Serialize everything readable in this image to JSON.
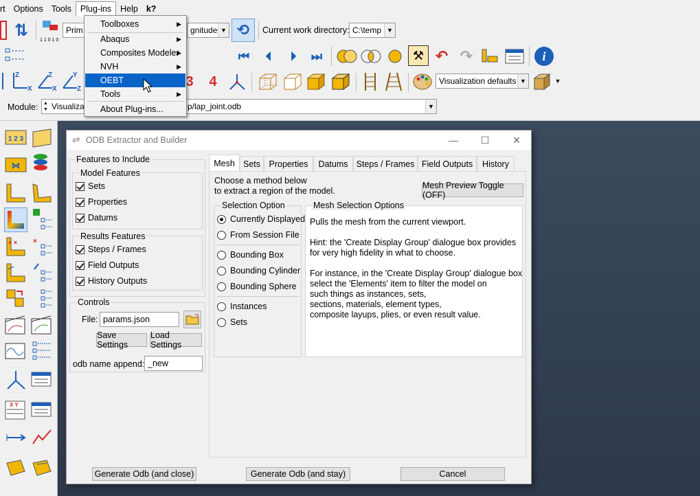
{
  "menubar": {
    "items": [
      "rt",
      "Options",
      "Tools",
      "Plug-ins",
      "Help"
    ],
    "whats_this": "k?"
  },
  "plugins_menu": {
    "items": [
      {
        "label": "Toolboxes",
        "has_submenu": true
      },
      {
        "label": "Abaqus",
        "has_submenu": true
      },
      {
        "label": "Composites Modeler",
        "has_submenu": true
      },
      {
        "label": "NVH",
        "has_submenu": true
      },
      {
        "label": "OEBT",
        "has_submenu": false,
        "highlighted": true
      },
      {
        "label": "Tools",
        "has_submenu": true
      },
      {
        "label": "About Plug-ins...",
        "has_submenu": false
      }
    ]
  },
  "toolbar": {
    "prim_combo": "Prim",
    "magnitude_combo": "gnitude",
    "cwd_label": "Current work directory:",
    "cwd_value": "C:\\temp",
    "viz_defaults": "Visualization defaults",
    "numbers": [
      "3",
      "4"
    ],
    "counter": "1 1 0 1 0"
  },
  "context": {
    "module_label": "Module:",
    "module_value": "Visualizat",
    "odb_path": "p/lap_joint.odb"
  },
  "dialog": {
    "title": "ODB Extractor and Builder",
    "features_label": "Features to Include",
    "model_features_label": "Model Features",
    "model_features": [
      "Sets",
      "Properties",
      "Datums"
    ],
    "results_features_label": "Results Features",
    "results_features": [
      "Steps / Frames",
      "Field Outputs",
      "History Outputs"
    ],
    "controls_label": "Controls",
    "file_label": "File:",
    "file_value": "params.json",
    "save_settings": "Save Settings",
    "load_settings": "Load Settings",
    "odb_append_label": "odb name append:",
    "odb_append_value": "_new",
    "tabs": [
      "Mesh",
      "Sets",
      "Properties",
      "Datums",
      "Steps / Frames",
      "Field Outputs",
      "History"
    ],
    "active_tab": "Mesh",
    "choose_text_1": "Choose a method below",
    "choose_text_2": "to extract a region of the model.",
    "preview_toggle": "Mesh Preview Toggle (OFF)",
    "selection_option_label": "Selection Option",
    "selection_options": [
      "Currently Displayed",
      "From Session File",
      "Bounding Box",
      "Bounding Cylinder",
      "Bounding Sphere",
      "Instances",
      "Sets"
    ],
    "selected_option": "Currently Displayed",
    "mesh_options_label": "Mesh Selection Options",
    "mesh_text": [
      "Pulls the mesh from the current viewport.",
      "Hint: the 'Create Display Group' dialogue box provides",
      "for very high fidelity in what to choose.",
      "For instance, in the 'Create Display Group' dialogue box",
      "select the 'Elements' item to filter the model on",
      "such things as instances, sets,",
      "sections, materials, element types,",
      "composite layups, plies, or even result value."
    ],
    "generate_close": "Generate Odb (and close)",
    "generate_stay": "Generate Odb (and stay)",
    "cancel": "Cancel"
  },
  "colors": {
    "highlight": "#0a64c8",
    "viewport_top": "#3c4a5e",
    "viewport_bottom": "#2d394a",
    "accent_red": "#d42a2a",
    "accent_blue": "#1d5fb8",
    "accent_yellow": "#f2b705"
  }
}
